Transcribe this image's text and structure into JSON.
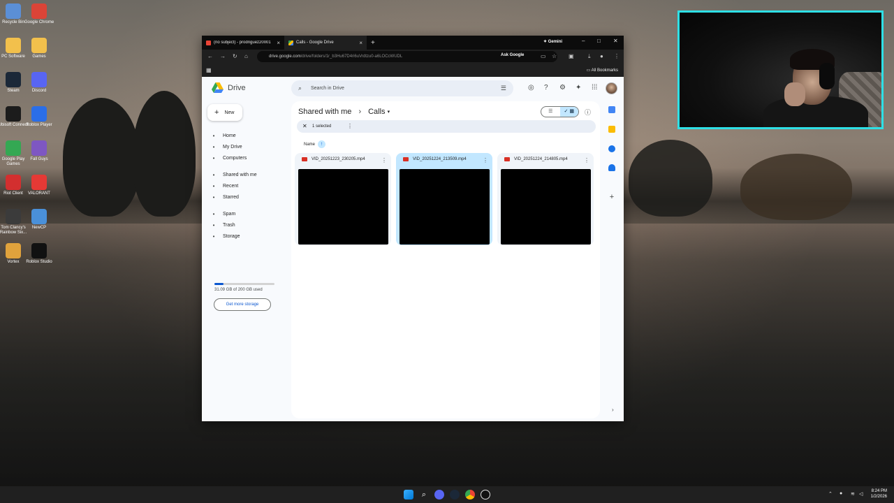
{
  "desktop_icons": [
    {
      "label": "Recycle Bin",
      "icon": "recycle-bin-icon",
      "color": "#5b8fd6"
    },
    {
      "label": "Google Chrome",
      "icon": "chrome-icon",
      "color": "#db4437"
    },
    {
      "label": "PC Software",
      "icon": "folder-icon",
      "color": "#f2c04c"
    },
    {
      "label": "Games",
      "icon": "folder-icon",
      "color": "#f2c04c"
    },
    {
      "label": "Steam",
      "icon": "steam-icon",
      "color": "#1b2838"
    },
    {
      "label": "Discord",
      "icon": "discord-icon",
      "color": "#5865f2"
    },
    {
      "label": "Ubisoft Connect",
      "icon": "ubisoft-icon",
      "color": "#1c1c1c"
    },
    {
      "label": "Roblox Player",
      "icon": "roblox-icon",
      "color": "#2a6ee8"
    },
    {
      "label": "Google Play Games",
      "icon": "play-games-icon",
      "color": "#34a853"
    },
    {
      "label": "Fall Guys",
      "icon": "fall-guys-icon",
      "color": "#7e57c2"
    },
    {
      "label": "Riot Client",
      "icon": "riot-icon",
      "color": "#d32f2f"
    },
    {
      "label": "VALORANT",
      "icon": "valorant-icon",
      "color": "#e53935"
    },
    {
      "label": "Tom Clancy's Rainbow Six...",
      "icon": "rainbow-six-icon",
      "color": "#3b3b3b"
    },
    {
      "label": "NewCP",
      "icon": "newcp-icon",
      "color": "#4a90d9"
    },
    {
      "label": "Vortex",
      "icon": "vortex-icon",
      "color": "#e0a23c"
    },
    {
      "label": "Roblox Studio",
      "icon": "roblox-studio-icon",
      "color": "#111111"
    }
  ],
  "browser": {
    "tabs": [
      {
        "title": "(no subject) - prodriguez20001",
        "favicon": "gmail-icon",
        "active": false
      },
      {
        "title": "Calls - Google Drive",
        "favicon": "drive-icon",
        "active": true
      }
    ],
    "new_tab": "+",
    "gemini": "Gemini",
    "url_host": "drive.google.com",
    "url_path": "/drive/folders/1r_b3Hu67D4ri6uVrdtzu0-a6LOCcWUDL",
    "ask_google": "Ask Google",
    "all_bookmarks": "All Bookmarks"
  },
  "drive": {
    "app_name": "Drive",
    "search_placeholder": "Search in Drive",
    "new_label": "New",
    "nav": [
      {
        "label": "Home",
        "icon": "home-icon"
      },
      {
        "label": "My Drive",
        "icon": "my-drive-icon"
      },
      {
        "label": "Computers",
        "icon": "computers-icon"
      },
      {
        "label": "Shared with me",
        "icon": "shared-icon"
      },
      {
        "label": "Recent",
        "icon": "clock-icon"
      },
      {
        "label": "Starred",
        "icon": "star-icon"
      },
      {
        "label": "Spam",
        "icon": "spam-icon"
      },
      {
        "label": "Trash",
        "icon": "trash-icon"
      },
      {
        "label": "Storage",
        "icon": "cloud-icon"
      }
    ],
    "storage_used_fraction": 0.155,
    "storage_text": "31.09 GB of 200 GB used",
    "get_more_storage": "Get more storage",
    "breadcrumb_parent": "Shared with me",
    "breadcrumb_current": "Calls",
    "selected_text": "1 selected",
    "sort_label": "Name",
    "files": [
      {
        "name": "VID_20251223_230205.mp4",
        "selected": false
      },
      {
        "name": "VID_20251224_213509.mp4",
        "selected": true
      },
      {
        "name": "VID_20251224_214805.mp4",
        "selected": false
      }
    ]
  },
  "taskbar": {
    "time": "8:24 PM",
    "date": "1/2/2026"
  }
}
